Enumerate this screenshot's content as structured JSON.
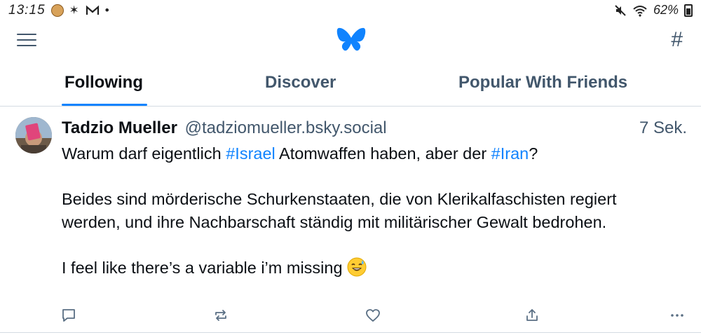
{
  "status_bar": {
    "time": "13:15",
    "battery": "62%",
    "left_icons": [
      "app-avatar-icon",
      "bluetooth-icon",
      "mail-icon",
      "dot-icon"
    ],
    "right_icons": [
      "mute-icon",
      "wifi-icon",
      "battery-icon"
    ]
  },
  "header": {
    "menu_icon": "hamburger-menu-icon",
    "logo": "butterfly-logo",
    "right_icon": "hashtag-feeds-icon"
  },
  "tabs": [
    {
      "label": "Following",
      "active": true
    },
    {
      "label": "Discover",
      "active": false
    },
    {
      "label": "Popular With Friends",
      "active": false
    }
  ],
  "post": {
    "author_name": "Tadzio Mueller",
    "author_handle": "@tadziomueller.bsky.social",
    "time": "7 Sek.",
    "line1_before": "Warum darf eigentlich ",
    "hashtag1": "#Israel",
    "line1_middle": " Atomwaffen haben, aber der ",
    "hashtag2": "#Iran",
    "line1_after": "?",
    "paragraph2": "Beides sind mörderische Schurkenstaaten, die von Klerikalfaschisten regiert werden, und ihre Nachbarschaft ständig mit militärischer Gewalt bedrohen.",
    "paragraph3": "I feel like there’s a variable i’m missing",
    "emoji": "grinning-sweat-emoji"
  },
  "actions": [
    "reply-icon",
    "repost-icon",
    "like-icon",
    "share-icon",
    "more-icon"
  ],
  "colors": {
    "accent": "#1083fe",
    "text": "#0b0f14",
    "muted": "#42576c",
    "divider": "#d4dbe2"
  }
}
